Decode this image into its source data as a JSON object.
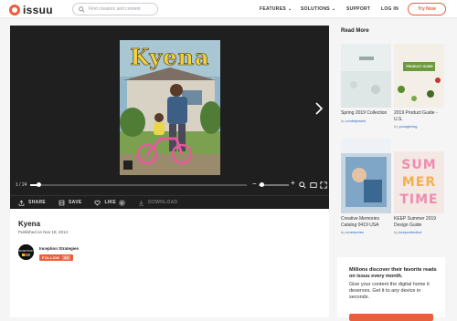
{
  "header": {
    "logo_text": "issuu",
    "search_placeholder": "Find creators and content",
    "nav": [
      {
        "label": "FEATURES",
        "has_dropdown": true
      },
      {
        "label": "SOLUTIONS",
        "has_dropdown": true
      },
      {
        "label": "SUPPORT",
        "has_dropdown": false
      },
      {
        "label": "LOG IN",
        "has_dropdown": false
      }
    ],
    "try_button": "Try Now",
    "chevron": "⌄"
  },
  "viewer": {
    "cover_title": "Kyena",
    "page_indicator": "1 / 24",
    "progress_fraction": 0.04,
    "zoom_minus": "−",
    "zoom_plus": "+",
    "zoom_fraction": 0.1,
    "actions": [
      {
        "label": "SHARE",
        "icon": "share-icon"
      },
      {
        "label": "SAVE",
        "icon": "save-icon"
      },
      {
        "label": "LIKE",
        "icon": "heart-icon",
        "count": "0"
      },
      {
        "label": "DOWNLOAD",
        "icon": "download-icon",
        "disabled": true
      }
    ]
  },
  "document": {
    "title": "Kyena",
    "published": "Published on Nov 18, 2014",
    "publisher": "Inception Strategies",
    "follow_label": "FOLLOW",
    "follow_count": "33"
  },
  "read_more": {
    "heading": "Read More",
    "cards": [
      {
        "title": "Spring 2019 Collection",
        "by": "by",
        "author": "vonfeljewels"
      },
      {
        "title": "2019 Product Guide - U.S.",
        "by": "by",
        "author": "youngliving"
      },
      {
        "title": "Creative Memories Catalog 0419 USA",
        "by": "by",
        "author": "cmemories"
      },
      {
        "title": "KEEP Summer 2019 Design Guide",
        "by": "by",
        "author": "keepcollective"
      }
    ]
  },
  "promo": {
    "headline": "Millions discover their favorite reads on issuu every month.",
    "body": "Give your content the digital home it deserves. Get it to any device in seconds."
  },
  "colors": {
    "accent": "#ee5d3b",
    "viewer_bg": "#1f1f1f",
    "link": "#2a64c5"
  }
}
